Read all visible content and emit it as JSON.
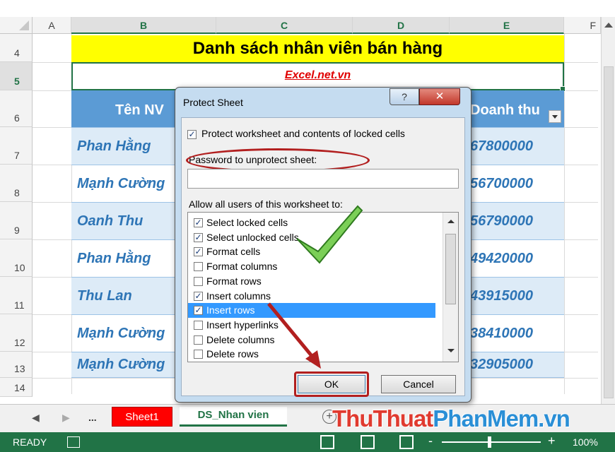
{
  "columns": [
    {
      "id": "A",
      "label": "A"
    },
    {
      "id": "B",
      "label": "B"
    },
    {
      "id": "C",
      "label": "C"
    },
    {
      "id": "D",
      "label": "D"
    },
    {
      "id": "E",
      "label": "E"
    },
    {
      "id": "F",
      "label": "F"
    }
  ],
  "rows": [
    "4",
    "5",
    "6",
    "7",
    "8",
    "9",
    "10",
    "11",
    "12",
    "13",
    "14"
  ],
  "sheet": {
    "title": "Danh sách nhân viên bán hàng",
    "subtitle": "Excel.net.vn",
    "header_name": "Tên NV",
    "header_sales": "Doanh thu",
    "records": [
      {
        "name": "Phan Hằng",
        "sales": "67800000"
      },
      {
        "name": "Mạnh Cường",
        "sales": "56700000"
      },
      {
        "name": "Oanh Thu",
        "sales": "56790000"
      },
      {
        "name": "Phan Hằng",
        "sales": "49420000"
      },
      {
        "name": "Thu Lan",
        "sales": "43915000"
      },
      {
        "name": "Mạnh Cường",
        "sales": "38410000"
      },
      {
        "name": "Mạnh Cường",
        "sales": "32905000"
      }
    ]
  },
  "dialog": {
    "title": "Protect Sheet",
    "help_label": "?",
    "close_label": "✕",
    "protect_label": "Protect worksheet and contents of locked cells",
    "protect_checked": true,
    "password_label": "Password to unprotect sheet:",
    "password_value": "",
    "allow_label": "Allow all users of this worksheet to:",
    "permissions": [
      {
        "label": "Select locked cells",
        "checked": true,
        "selected": false
      },
      {
        "label": "Select unlocked cells",
        "checked": true,
        "selected": false
      },
      {
        "label": "Format cells",
        "checked": true,
        "selected": false
      },
      {
        "label": "Format columns",
        "checked": false,
        "selected": false
      },
      {
        "label": "Format rows",
        "checked": false,
        "selected": false
      },
      {
        "label": "Insert columns",
        "checked": true,
        "selected": false
      },
      {
        "label": "Insert rows",
        "checked": true,
        "selected": true
      },
      {
        "label": "Insert hyperlinks",
        "checked": false,
        "selected": false
      },
      {
        "label": "Delete columns",
        "checked": false,
        "selected": false
      },
      {
        "label": "Delete rows",
        "checked": false,
        "selected": false
      }
    ],
    "ok_label": "OK",
    "cancel_label": "Cancel"
  },
  "tabs": {
    "more_label": "...",
    "sheet1_label": "Sheet1",
    "ds_label": "DS_Nhan vien",
    "add_label": "+"
  },
  "watermark": {
    "part1": "ThuThuat",
    "part2": "PhanMem.vn"
  },
  "status": {
    "ready": "READY",
    "zoom_minus": "-",
    "zoom_plus": "+",
    "zoom": "100%"
  },
  "colors": {
    "accent": "#217346",
    "header_fill": "#5b9bd5",
    "title_fill": "#ffff00",
    "annotation": "#b21f1f",
    "check_mark": "#6cc04a"
  },
  "icons": [
    "macro-record-icon",
    "normal-view-icon",
    "page-layout-view-icon",
    "page-break-view-icon",
    "checkmark-annotation-icon",
    "arrow-annotation-icon"
  ]
}
